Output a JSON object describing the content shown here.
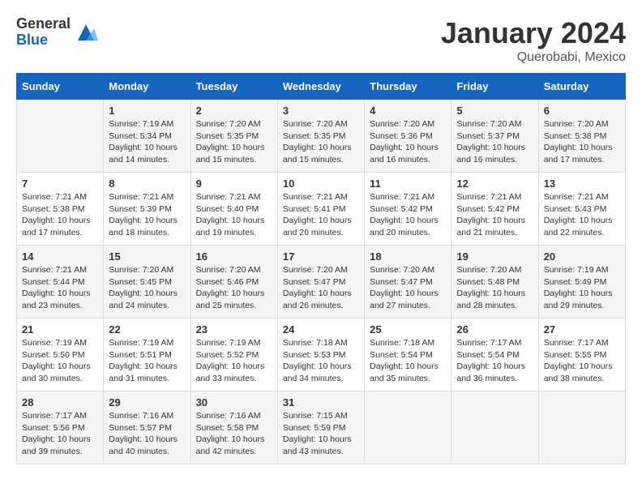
{
  "header": {
    "logo": {
      "general": "General",
      "blue": "Blue"
    },
    "title": "January 2024",
    "location": "Querobabi, Mexico"
  },
  "weekdays": [
    "Sunday",
    "Monday",
    "Tuesday",
    "Wednesday",
    "Thursday",
    "Friday",
    "Saturday"
  ],
  "weeks": [
    [
      {
        "day": "",
        "info": ""
      },
      {
        "day": "1",
        "info": "Sunrise: 7:19 AM\nSunset: 5:34 PM\nDaylight: 10 hours\nand 14 minutes."
      },
      {
        "day": "2",
        "info": "Sunrise: 7:20 AM\nSunset: 5:35 PM\nDaylight: 10 hours\nand 15 minutes."
      },
      {
        "day": "3",
        "info": "Sunrise: 7:20 AM\nSunset: 5:35 PM\nDaylight: 10 hours\nand 15 minutes."
      },
      {
        "day": "4",
        "info": "Sunrise: 7:20 AM\nSunset: 5:36 PM\nDaylight: 10 hours\nand 16 minutes."
      },
      {
        "day": "5",
        "info": "Sunrise: 7:20 AM\nSunset: 5:37 PM\nDaylight: 10 hours\nand 16 minutes."
      },
      {
        "day": "6",
        "info": "Sunrise: 7:20 AM\nSunset: 5:38 PM\nDaylight: 10 hours\nand 17 minutes."
      }
    ],
    [
      {
        "day": "7",
        "info": "Sunrise: 7:21 AM\nSunset: 5:38 PM\nDaylight: 10 hours\nand 17 minutes."
      },
      {
        "day": "8",
        "info": "Sunrise: 7:21 AM\nSunset: 5:39 PM\nDaylight: 10 hours\nand 18 minutes."
      },
      {
        "day": "9",
        "info": "Sunrise: 7:21 AM\nSunset: 5:40 PM\nDaylight: 10 hours\nand 19 minutes."
      },
      {
        "day": "10",
        "info": "Sunrise: 7:21 AM\nSunset: 5:41 PM\nDaylight: 10 hours\nand 20 minutes."
      },
      {
        "day": "11",
        "info": "Sunrise: 7:21 AM\nSunset: 5:42 PM\nDaylight: 10 hours\nand 20 minutes."
      },
      {
        "day": "12",
        "info": "Sunrise: 7:21 AM\nSunset: 5:42 PM\nDaylight: 10 hours\nand 21 minutes."
      },
      {
        "day": "13",
        "info": "Sunrise: 7:21 AM\nSunset: 5:43 PM\nDaylight: 10 hours\nand 22 minutes."
      }
    ],
    [
      {
        "day": "14",
        "info": "Sunrise: 7:21 AM\nSunset: 5:44 PM\nDaylight: 10 hours\nand 23 minutes."
      },
      {
        "day": "15",
        "info": "Sunrise: 7:20 AM\nSunset: 5:45 PM\nDaylight: 10 hours\nand 24 minutes."
      },
      {
        "day": "16",
        "info": "Sunrise: 7:20 AM\nSunset: 5:46 PM\nDaylight: 10 hours\nand 25 minutes."
      },
      {
        "day": "17",
        "info": "Sunrise: 7:20 AM\nSunset: 5:47 PM\nDaylight: 10 hours\nand 26 minutes."
      },
      {
        "day": "18",
        "info": "Sunrise: 7:20 AM\nSunset: 5:47 PM\nDaylight: 10 hours\nand 27 minutes."
      },
      {
        "day": "19",
        "info": "Sunrise: 7:20 AM\nSunset: 5:48 PM\nDaylight: 10 hours\nand 28 minutes."
      },
      {
        "day": "20",
        "info": "Sunrise: 7:19 AM\nSunset: 5:49 PM\nDaylight: 10 hours\nand 29 minutes."
      }
    ],
    [
      {
        "day": "21",
        "info": "Sunrise: 7:19 AM\nSunset: 5:50 PM\nDaylight: 10 hours\nand 30 minutes."
      },
      {
        "day": "22",
        "info": "Sunrise: 7:19 AM\nSunset: 5:51 PM\nDaylight: 10 hours\nand 31 minutes."
      },
      {
        "day": "23",
        "info": "Sunrise: 7:19 AM\nSunset: 5:52 PM\nDaylight: 10 hours\nand 33 minutes."
      },
      {
        "day": "24",
        "info": "Sunrise: 7:18 AM\nSunset: 5:53 PM\nDaylight: 10 hours\nand 34 minutes."
      },
      {
        "day": "25",
        "info": "Sunrise: 7:18 AM\nSunset: 5:54 PM\nDaylight: 10 hours\nand 35 minutes."
      },
      {
        "day": "26",
        "info": "Sunrise: 7:17 AM\nSunset: 5:54 PM\nDaylight: 10 hours\nand 36 minutes."
      },
      {
        "day": "27",
        "info": "Sunrise: 7:17 AM\nSunset: 5:55 PM\nDaylight: 10 hours\nand 38 minutes."
      }
    ],
    [
      {
        "day": "28",
        "info": "Sunrise: 7:17 AM\nSunset: 5:56 PM\nDaylight: 10 hours\nand 39 minutes."
      },
      {
        "day": "29",
        "info": "Sunrise: 7:16 AM\nSunset: 5:57 PM\nDaylight: 10 hours\nand 40 minutes."
      },
      {
        "day": "30",
        "info": "Sunrise: 7:16 AM\nSunset: 5:58 PM\nDaylight: 10 hours\nand 42 minutes."
      },
      {
        "day": "31",
        "info": "Sunrise: 7:15 AM\nSunset: 5:59 PM\nDaylight: 10 hours\nand 43 minutes."
      },
      {
        "day": "",
        "info": ""
      },
      {
        "day": "",
        "info": ""
      },
      {
        "day": "",
        "info": ""
      }
    ]
  ]
}
